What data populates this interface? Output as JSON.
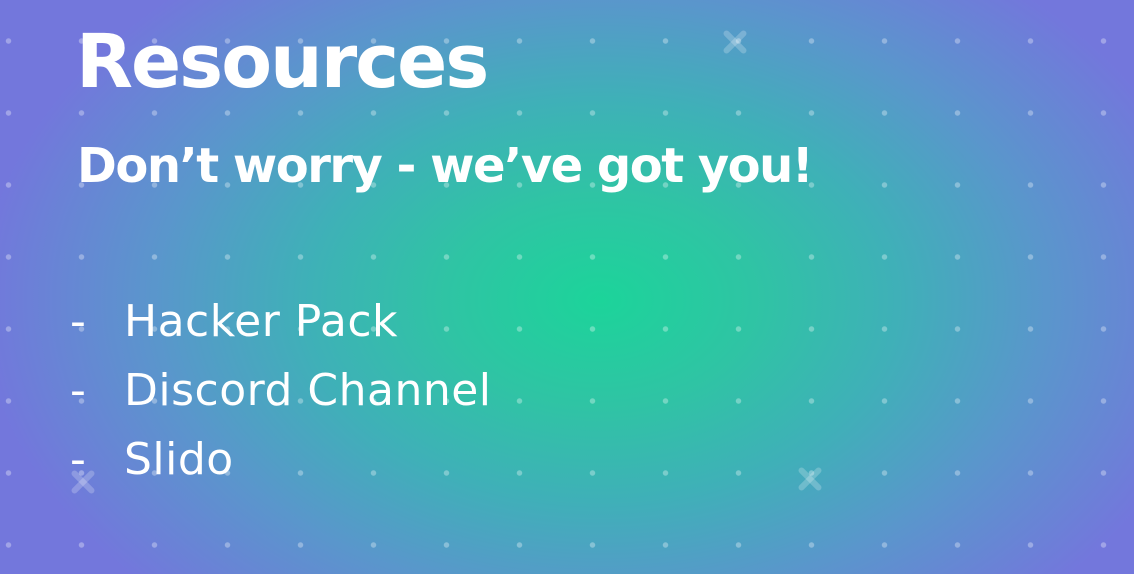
{
  "slide": {
    "title": "Resources",
    "subtitle": "Don’t worry - we’ve got you!",
    "items": [
      {
        "dash": "-",
        "label": "Hacker Pack"
      },
      {
        "dash": "-",
        "label": "Discord Channel"
      },
      {
        "dash": "-",
        "label": "Slido"
      }
    ]
  },
  "colors": {
    "center_glow": "#1cd49a",
    "edge": "#7377dc",
    "text": "#ffffff"
  },
  "decorations": {
    "background_pattern": "dot-grid",
    "accent_icon": "cross-icon"
  }
}
